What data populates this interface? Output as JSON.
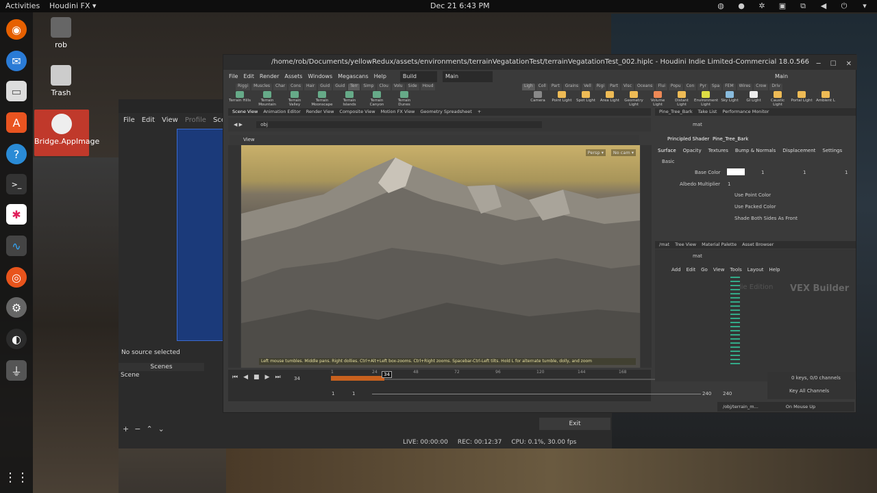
{
  "topbar": {
    "activities": "Activities",
    "app": "Houdini FX ▾",
    "clock": "Dec 21  6:43 PM"
  },
  "desktop": {
    "home_label": "rob",
    "trash_label": "Trash",
    "bridge_label": "Bridge.AppImage"
  },
  "obs": {
    "menu": [
      "File",
      "Edit",
      "View",
      "Profile",
      "Scene C"
    ],
    "no_source": "No source selected",
    "scenes_header": "Scenes",
    "scene_item": "Scene",
    "live": "LIVE: 00:00:00",
    "rec": "REC: 00:12:37",
    "cpu": "CPU: 0.1%, 30.00 fps",
    "exit": "Exit"
  },
  "houdini": {
    "title": "/home/rob/Documents/yellowRedux/assets/environments/terrainVegatationTest/terrainVegatationTest_002.hiplc - Houdini Indie Limited-Commercial 18.0.566",
    "menu": [
      "File",
      "Edit",
      "Render",
      "Assets",
      "Windows",
      "Megascans",
      "Help"
    ],
    "desktop_select": "Build",
    "desktop_main": "Main",
    "desktop_main_right": "Main",
    "shelf_tabs_left": [
      "Riggi",
      "Muscles",
      "Char",
      "Cons",
      "Hair",
      "Guid",
      "Guid",
      "Terr",
      "Simp",
      "Clou",
      "Volu",
      "Side",
      "Houd"
    ],
    "shelf_tabs_right": [
      "Ligh",
      "Coll",
      "Part",
      "Grains",
      "Vell",
      "Rigi",
      "Part",
      "Visc",
      "Oceans",
      "Flui",
      "Popu",
      "Con",
      "Pyr",
      "Spa",
      "FEM",
      "Wires",
      "Crow",
      "Driv"
    ],
    "tools_left": [
      "Terrain Hills",
      "Terrain Mountain",
      "Terrain Valley",
      "Terrain Moonscape",
      "Terrain Islands",
      "Terrain Canyon",
      "Terrain Dunes"
    ],
    "tools_right": [
      "Camera",
      "Point Light",
      "Spot Light",
      "Area Light",
      "Geometry Light",
      "Volume Light",
      "Distant Light",
      "Environment Light",
      "Sky Light",
      "GI Light",
      "Caustic Light",
      "Portal Light",
      "Ambient L"
    ],
    "pane_tabs": [
      "Scene View",
      "Animation Editor",
      "Render View",
      "Composite View",
      "Motion FX View",
      "Geometry Spreadsheet"
    ],
    "path": "obj",
    "view_label": "View",
    "persp": "Persp ▾",
    "nocam": "No cam ▾",
    "hint": "Left mouse tumbles. Middle pans. Right dollies. Ctrl+Alt+Left box-zooms. Ctrl+Right zooms. Spacebar-Ctrl-Left tilts. Hold L for alternate tumble, dolly, and zoom",
    "frame": "34",
    "frame_marker": "34",
    "start": "1",
    "start2": "1",
    "end": "240",
    "end2": "240",
    "ruler": [
      "1",
      "24",
      "48",
      "72",
      "96",
      "120",
      "144",
      "168",
      "192",
      "216"
    ],
    "right_tabs": [
      "Pine_Tree_Bark",
      "Take List",
      "Performance Monitor"
    ],
    "mat_path": "mat",
    "shader_type": "Principled Shader",
    "shader_name": "Pine_Tree_Bark",
    "param_tabs": [
      "Surface",
      "Opacity",
      "Textures",
      "Bump & Normals",
      "Displacement",
      "Settings"
    ],
    "section": "Basic",
    "base_color": "Base Color",
    "bc_vals": [
      "1",
      "1",
      "1"
    ],
    "albedo": "Albedo Multiplier",
    "albedo_val": "1",
    "checks": [
      "Use Point Color",
      "Use Packed Color",
      "Shade Both Sides As Front"
    ],
    "net_tabs": [
      "/mat",
      "Tree View",
      "Material Palette",
      "Asset Browser"
    ],
    "net_path": "mat",
    "net_menu": [
      "Add",
      "Edit",
      "Go",
      "View",
      "Tools",
      "Layout",
      "Help"
    ],
    "vex": "VEX Builder",
    "edition": "Indie Edition",
    "keys": "0 keys, 0/0 channels",
    "keyall": "Key All Channels",
    "status_path": "/obj/terrain_m...",
    "onmouse": "On Mouse Up"
  }
}
